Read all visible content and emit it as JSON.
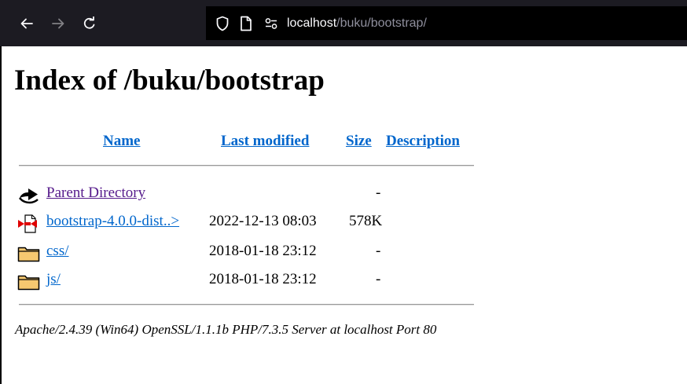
{
  "browser": {
    "url_host": "localhost",
    "url_path": "/buku/bootstrap/",
    "icons": {
      "back": "arrow-left-icon",
      "forward": "arrow-right-icon",
      "reload": "reload-icon",
      "shield": "shield-icon",
      "page": "page-icon",
      "permissions": "permissions-icon"
    }
  },
  "page": {
    "title": "Index of /buku/bootstrap",
    "columns": {
      "name": "Name",
      "last_modified": "Last modified",
      "size": "Size",
      "description": "Description"
    },
    "rows": [
      {
        "name": "Parent Directory",
        "modified": "",
        "size": "-",
        "icon": "back-folder-icon"
      },
      {
        "name": "bootstrap-4.0.0-dist..>",
        "modified": "2022-12-13 08:03",
        "size": "578K",
        "icon": "compressed-file-icon"
      },
      {
        "name": "css/",
        "modified": "2018-01-18 23:12",
        "size": "-",
        "icon": "folder-icon"
      },
      {
        "name": "js/",
        "modified": "2018-01-18 23:12",
        "size": "-",
        "icon": "folder-icon"
      }
    ],
    "footer": "Apache/2.4.39 (Win64) OpenSSL/1.1.1b PHP/7.3.5 Server at localhost Port 80"
  }
}
